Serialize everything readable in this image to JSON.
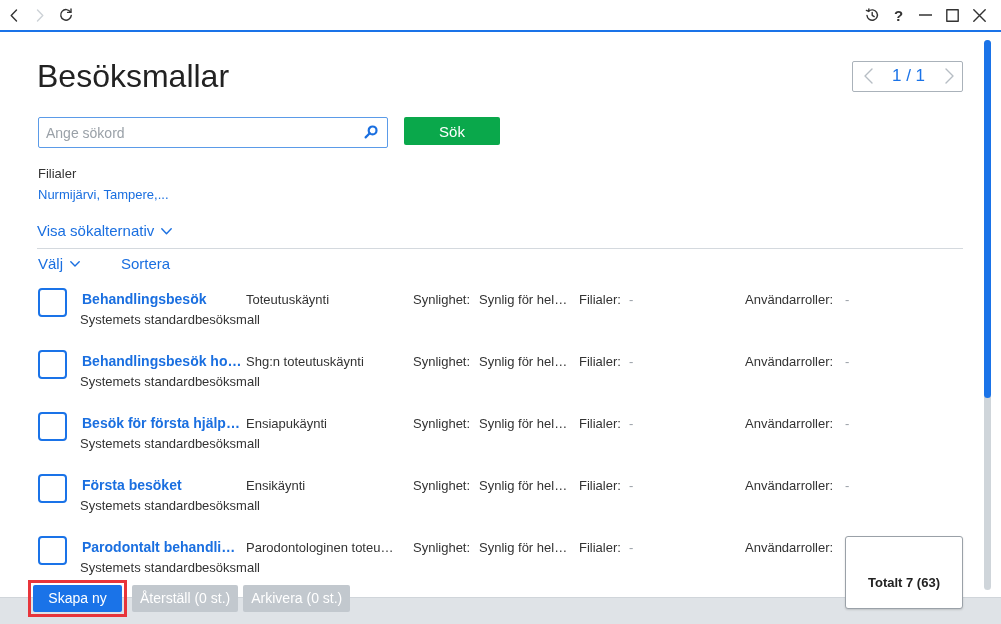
{
  "titlebar": {
    "nav": [
      {
        "kind": "back",
        "disabled": false
      },
      {
        "kind": "forward",
        "disabled": true
      },
      {
        "kind": "refresh",
        "disabled": false
      }
    ],
    "controls": [
      {
        "kind": "history"
      },
      {
        "kind": "help",
        "label": "?"
      },
      {
        "kind": "minimize"
      },
      {
        "kind": "maximize"
      },
      {
        "kind": "close"
      }
    ]
  },
  "page": {
    "title": "Besöksmallar",
    "pager": {
      "label": "1 / 1",
      "prev_disabled": true,
      "next_disabled": true
    }
  },
  "search": {
    "placeholder": "Ange sökord",
    "button": "Sök"
  },
  "filter": {
    "label": "Filialer",
    "value": "Nurmijärvi, Tampere,..."
  },
  "options_toggle": {
    "label": "Visa sökalternativ",
    "expanded": false
  },
  "list_toolbar": {
    "select": "Välj",
    "sort": "Sortera"
  },
  "templates": [
    {
      "checked": false,
      "name": "Behandlingsbesök",
      "type": "Toteutuskäynti",
      "visibility_label": "Synlighet:",
      "visibility": "Synlig för hel…",
      "branches_label": "Filialer:",
      "branches": "-",
      "roles_label": "Användarroller:",
      "roles": "-",
      "description": "Systemets standardbesöksmall"
    },
    {
      "checked": false,
      "name": "Behandlingsbesök ho…",
      "type": "Shg:n toteutuskäynti",
      "visibility_label": "Synlighet:",
      "visibility": "Synlig för hel…",
      "branches_label": "Filialer:",
      "branches": "-",
      "roles_label": "Användarroller:",
      "roles": "-",
      "description": "Systemets standardbesöksmall"
    },
    {
      "checked": false,
      "name": "Besök för första hjälp…",
      "type": "Ensiapukäynti",
      "visibility_label": "Synlighet:",
      "visibility": "Synlig för hel…",
      "branches_label": "Filialer:",
      "branches": "-",
      "roles_label": "Användarroller:",
      "roles": "-",
      "description": "Systemets standardbesöksmall"
    },
    {
      "checked": false,
      "name": "Första besöket",
      "type": "Ensikäynti",
      "visibility_label": "Synlighet:",
      "visibility": "Synlig för hel…",
      "branches_label": "Filialer:",
      "branches": "-",
      "roles_label": "Användarroller:",
      "roles": "-",
      "description": "Systemets standardbesöksmall"
    },
    {
      "checked": false,
      "name": "Parodontalt behandli…",
      "type": "Parodontologinen toteu…",
      "visibility_label": "Synlighet:",
      "visibility": "Synlig för hel…",
      "branches_label": "Filialer:",
      "branches": "-",
      "roles_label": "Användarroller:",
      "description": "Systemets standardbesöksmall"
    }
  ],
  "total": "Totalt 7 (63)",
  "actions": [
    {
      "label": "Skapa ny",
      "disabled": false,
      "highlighted": true
    },
    {
      "label": "Återställ (0 st.)",
      "disabled": true,
      "highlighted": false
    },
    {
      "label": "Arkivera (0 st.)",
      "disabled": true,
      "highlighted": false
    }
  ]
}
